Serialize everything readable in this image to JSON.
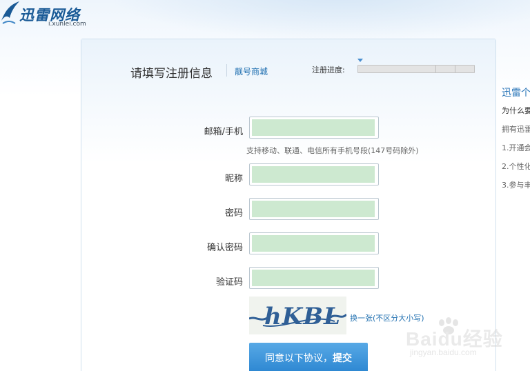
{
  "header": {
    "logo_title": "迅雷网络",
    "logo_domain": "i.xunlei.com"
  },
  "form": {
    "title": "请填写注册信息",
    "title_link": "靓号商城",
    "progress_label": "注册进度:",
    "progress": {
      "fraction": 0.0,
      "steps": 3
    },
    "fields": {
      "email_label": "邮箱/手机",
      "email_hint": "支持移动、联通、电信所有手机号段(147号码除外)",
      "nickname_label": "昵称",
      "password_label": "密码",
      "confirm_label": "确认密码",
      "captcha_label": "验证码"
    },
    "captcha_text": "hKBL",
    "captcha_refresh": "换一张(不区分大小写)",
    "submit_prefix": "同意以下协议，",
    "submit_bold": "提交"
  },
  "side_panel": {
    "title": "迅雷个",
    "lines": [
      "为什么要",
      "拥有迅雷",
      "1.开通会",
      "2.个性化",
      "3.参与丰"
    ]
  },
  "watermark": {
    "text": "Baidu经验",
    "url": "jingyan.baidu.com"
  },
  "colors": {
    "accent": "#2c86d1",
    "link": "#1f6fb0",
    "input_fill": "#cde9d0"
  }
}
